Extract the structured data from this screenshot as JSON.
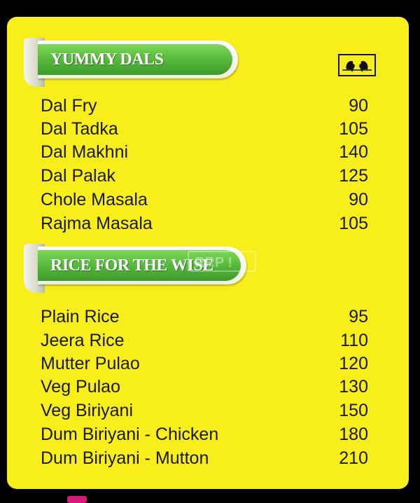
{
  "sections": [
    {
      "title": "YUMMY DALS",
      "items": [
        {
          "name": "Dal Fry",
          "price": "90"
        },
        {
          "name": "Dal Tadka",
          "price": "105"
        },
        {
          "name": "Dal Makhni",
          "price": "140"
        },
        {
          "name": "Dal Palak",
          "price": "125"
        },
        {
          "name": "Chole Masala",
          "price": "90"
        },
        {
          "name": "Rajma Masala",
          "price": "105"
        }
      ]
    },
    {
      "title": "RICE FOR THE WISE",
      "items": [
        {
          "name": "Plain Rice",
          "price": "95"
        },
        {
          "name": "Jeera Rice",
          "price": "110"
        },
        {
          "name": "Mutter Pulao",
          "price": "120"
        },
        {
          "name": "Veg Pulao",
          "price": "130"
        },
        {
          "name": "Veg Biriyani",
          "price": "150"
        },
        {
          "name": "Dum Biriyani - Chicken",
          "price": "180"
        },
        {
          "name": "Dum Biriyani - Mutton",
          "price": "210"
        }
      ]
    }
  ],
  "icons": {
    "badge": "birds-logo-icon"
  },
  "watermark": "RRP !",
  "colors": {
    "background": "#f8ee1c",
    "banner_green": "#52b63a",
    "text": "#1a1a1a"
  }
}
